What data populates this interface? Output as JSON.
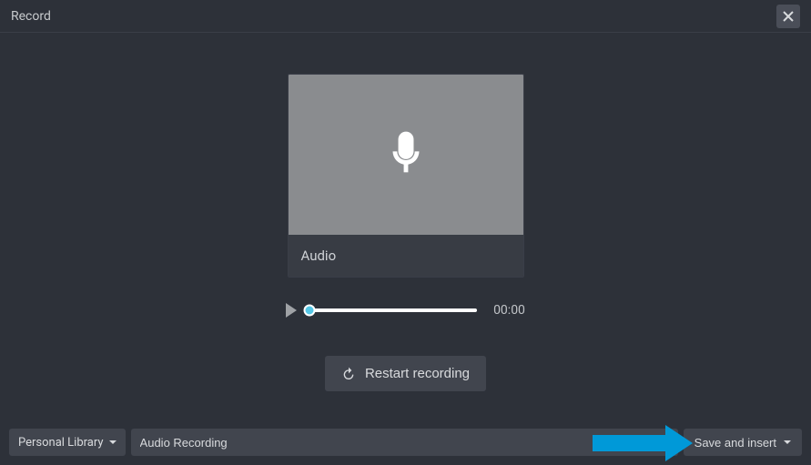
{
  "header": {
    "title": "Record"
  },
  "thumbnail": {
    "label": "Audio"
  },
  "player": {
    "time": "00:00"
  },
  "actions": {
    "restart_label": "Restart recording"
  },
  "footer": {
    "library_label": "Personal Library",
    "filename": "Audio Recording",
    "save_label": "Save and insert"
  }
}
